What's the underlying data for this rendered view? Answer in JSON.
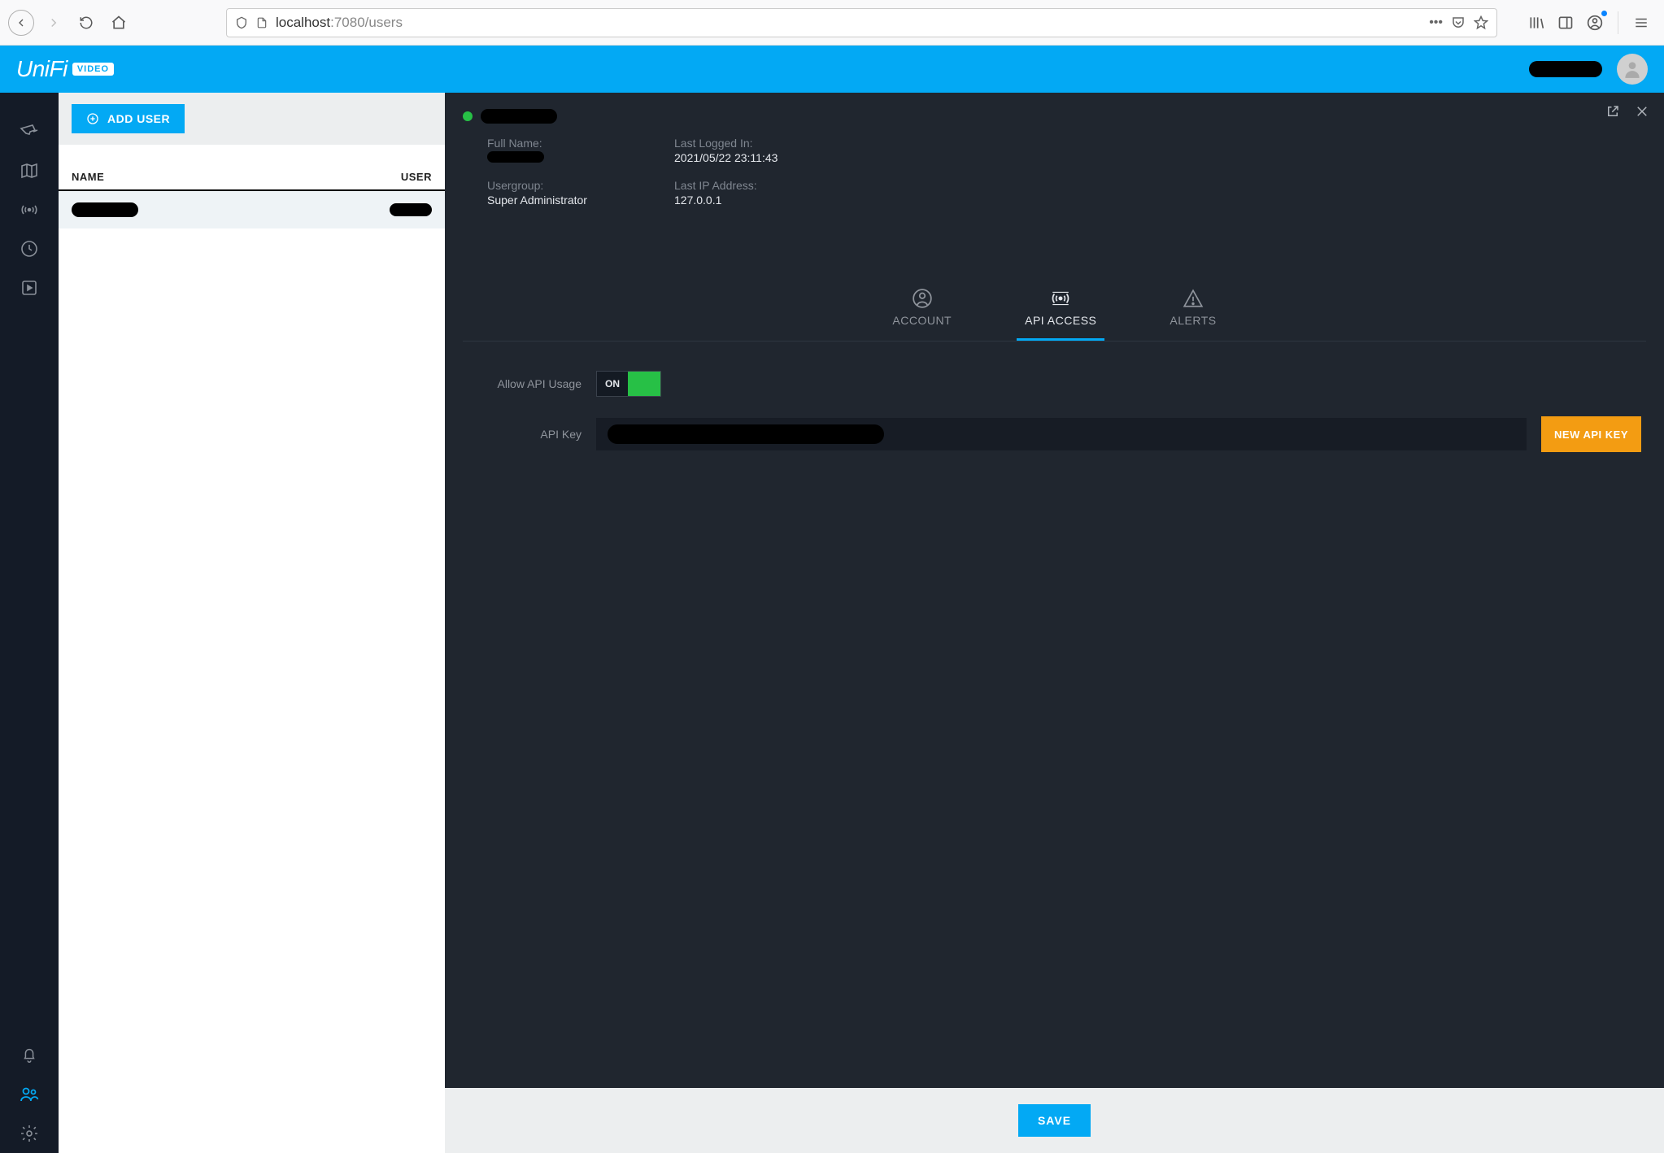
{
  "browser": {
    "url_display_host": "localhost",
    "url_display_path": ":7080/users"
  },
  "header": {
    "logo_text": "UniFi",
    "logo_badge": "VIDEO"
  },
  "sidebar": {
    "items": [
      {
        "name": "cameras",
        "icon": "camera"
      },
      {
        "name": "map",
        "icon": "map"
      },
      {
        "name": "liveview",
        "icon": "broadcast"
      },
      {
        "name": "timeline",
        "icon": "clock"
      },
      {
        "name": "recordings",
        "icon": "play-square"
      }
    ],
    "bottom": [
      {
        "name": "alerts",
        "icon": "bell"
      },
      {
        "name": "users",
        "icon": "users",
        "active": true
      },
      {
        "name": "settings",
        "icon": "gear"
      }
    ]
  },
  "list": {
    "add_user_label": "ADD USER",
    "columns": {
      "name": "NAME",
      "user": "USER"
    }
  },
  "detail": {
    "full_name_label": "Full Name:",
    "last_logged_label": "Last Logged In:",
    "last_logged_value": "2021/05/22 23:11:43",
    "usergroup_label": "Usergroup:",
    "usergroup_value": "Super Administrator",
    "last_ip_label": "Last IP Address:",
    "last_ip_value": "127.0.0.1",
    "tabs": {
      "account": "ACCOUNT",
      "api_access": "API ACCESS",
      "alerts": "ALERTS"
    },
    "allow_api_label": "Allow API Usage",
    "toggle_on": "ON",
    "api_key_label": "API Key",
    "new_api_key_label": "NEW API KEY",
    "save_label": "SAVE"
  }
}
